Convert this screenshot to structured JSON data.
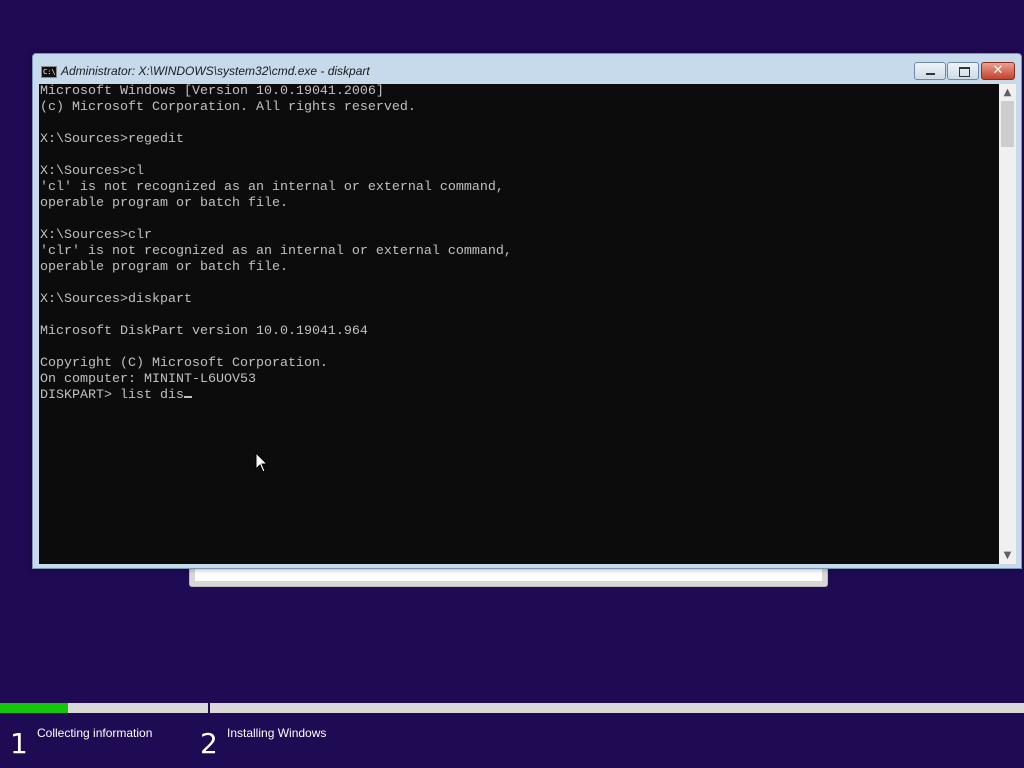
{
  "window": {
    "title": "Administrator: X:\\WINDOWS\\system32\\cmd.exe - diskpart",
    "icon": "cmd-icon",
    "icon_text": "C:\\",
    "close_glyph": "✕"
  },
  "console": {
    "lines": [
      "Microsoft Windows [Version 10.0.19041.2006]",
      "(c) Microsoft Corporation. All rights reserved.",
      "",
      "X:\\Sources>regedit",
      "",
      "X:\\Sources>cl",
      "'cl' is not recognized as an internal or external command,",
      "operable program or batch file.",
      "",
      "X:\\Sources>clr",
      "'clr' is not recognized as an internal or external command,",
      "operable program or batch file.",
      "",
      "X:\\Sources>diskpart",
      "",
      "Microsoft DiskPart version 10.0.19041.964",
      "",
      "Copyright (C) Microsoft Corporation.",
      "On computer: MININT-L6UOV53",
      ""
    ],
    "prompt": "DISKPART> ",
    "input": "list dis",
    "text_color": "#c0c0c0",
    "background": "#0c0c0c"
  },
  "scrollbar": {
    "up_glyph": "▲",
    "down_glyph": "▼"
  },
  "setup": {
    "progress_fraction": 0.066,
    "progress_color": "#16c60c",
    "background_color": "#1f0a54",
    "steps": [
      {
        "number": "1",
        "label": "Collecting information"
      },
      {
        "number": "2",
        "label": "Installing Windows"
      }
    ]
  }
}
